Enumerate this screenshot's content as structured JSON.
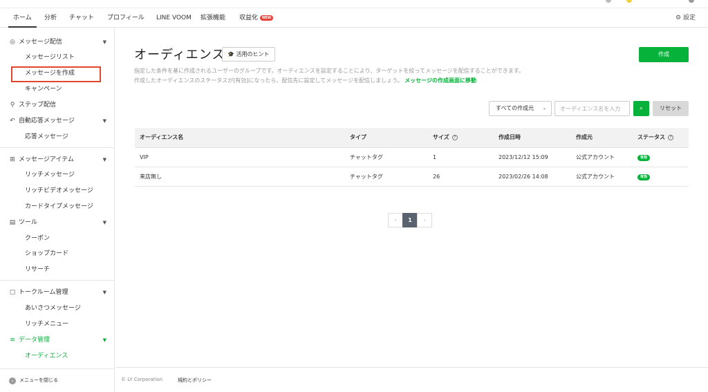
{
  "nav": {
    "tabs": [
      {
        "label": "ホーム",
        "active": true
      },
      {
        "label": "分析"
      },
      {
        "label": "チャット"
      },
      {
        "label": "プロフィール"
      },
      {
        "label": "LINE VOOM"
      },
      {
        "label": "拡張機能"
      },
      {
        "label": "収益化",
        "badge": "NEW"
      }
    ],
    "settings_label": "設定"
  },
  "sidebar": {
    "sections": [
      {
        "label": "メッセージ配信",
        "icon": "broadcast-icon",
        "items": [
          "メッセージリスト",
          "メッセージを作成",
          "キャンペーン"
        ]
      },
      {
        "label": "ステップ配信",
        "icon": "hierarchy-icon"
      },
      {
        "label": "自動応答メッセージ",
        "icon": "reply-icon",
        "items": [
          "応答メッセージ"
        ]
      },
      {
        "label": "メッセージアイテム",
        "icon": "plus-box-icon",
        "items": [
          "リッチメッセージ",
          "リッチビデオメッセージ",
          "カードタイプメッセージ"
        ]
      },
      {
        "label": "ツール",
        "icon": "store-icon",
        "items": [
          "クーポン",
          "ショップカード",
          "リサーチ"
        ]
      },
      {
        "label": "トークルーム管理",
        "icon": "chatroom-icon",
        "items": [
          "あいさつメッセージ",
          "リッチメニュー"
        ]
      },
      {
        "label": "データ管理",
        "icon": "database-icon",
        "active": true,
        "items": [
          "オーディエンス"
        ]
      }
    ],
    "collapse_label": "メニューを閉じる"
  },
  "main": {
    "title": "オーディエンス",
    "hint_label": "活用のヒント",
    "create_label": "作成",
    "description_line1": "指定した条件を基に作成されるユーザーのグループです。オーディエンスを設定することにより、ターゲットを絞ってメッセージを配信することができます。",
    "description_line2": "作成したオーディエンスのステータスが[有効]になったら、配信先に設定してメッセージを配信しましょう。",
    "description_link": "メッセージの作成画面に移動",
    "filter_select": "すべての作成元",
    "search_placeholder": "オーディエンス名を入力",
    "reset_label": "リセット",
    "table": {
      "headers": [
        "オーディエンス名",
        "タイプ",
        "サイズ",
        "作成日時",
        "作成元",
        "ステータス"
      ],
      "rows": [
        [
          "VIP",
          "チャットタグ",
          "1",
          "2023/12/12 15:09",
          "公式アカウント",
          "有効"
        ],
        [
          "来店無し",
          "チャットタグ",
          "26",
          "2023/02/26 14:08",
          "公式アカウント",
          "有効"
        ]
      ]
    },
    "pagination": {
      "current": "1",
      "prev": "‹",
      "next": "›"
    }
  },
  "footer": {
    "copyright": "© LY Corporation",
    "policy": "規約とポリシー"
  },
  "colors": {
    "accent": "#06b23a",
    "highlight_border": "#e0462a",
    "new_badge": "#e8443a"
  }
}
